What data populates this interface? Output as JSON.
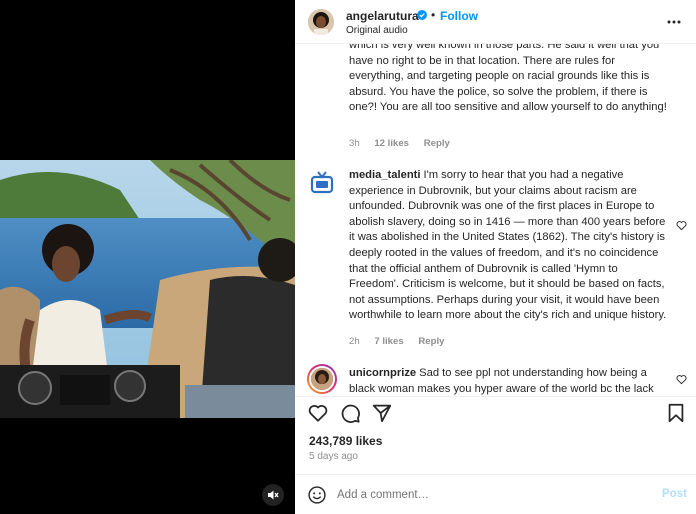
{
  "header": {
    "username": "angelarutura",
    "separator": "•",
    "follow_label": "Follow",
    "audio_label": "Original audio"
  },
  "comments": [
    {
      "username": "",
      "text": "which is very well known in those parts. He said it well that you have no right to be in that location. There are rules for everything, and targeting people on racial grounds like this is absurd. You have the police, so solve the problem, if there is one?! You are all too sensitive and allow yourself to do anything!",
      "time": "3h",
      "likes": "12 likes",
      "reply": "Reply"
    },
    {
      "username": "media_talenti",
      "text": "I'm sorry to hear that you had a negative experience in Dubrovnik, but your claims about racism are unfounded. Dubrovnik was one of the first places in Europe to abolish slavery, doing so in 1416 — more than 400 years before it was abolished in the United States (1862). The city's history is deeply rooted in the values of freedom, and it's no coincidence that the official anthem of Dubrovnik is called 'Hymn to Freedom'. Criticism is welcome, but it should be based on facts, not assumptions. Perhaps during your visit, it would have been worthwhile to learn more about the city's rich and unique history.",
      "time": "2h",
      "likes": "7 likes",
      "reply": "Reply"
    },
    {
      "username": "unicornprize",
      "text": "Sad to see ppl not understanding how being a black woman makes you hyper aware of the world bc the lack"
    }
  ],
  "post": {
    "likes_total": "243,789 likes",
    "posted_ago": "5 days ago"
  },
  "comment_box": {
    "placeholder": "Add a comment…",
    "post_label": "Post"
  },
  "colors": {
    "follow": "#0095f6",
    "post_disabled": "#b2dffc",
    "meta": "#8e8e8e",
    "text": "#262626"
  },
  "icons": [
    "verified-icon",
    "more-options-icon",
    "tv-icon",
    "heart-icon",
    "comment-icon",
    "share-icon",
    "bookmark-icon",
    "emoji-icon",
    "mute-icon"
  ]
}
